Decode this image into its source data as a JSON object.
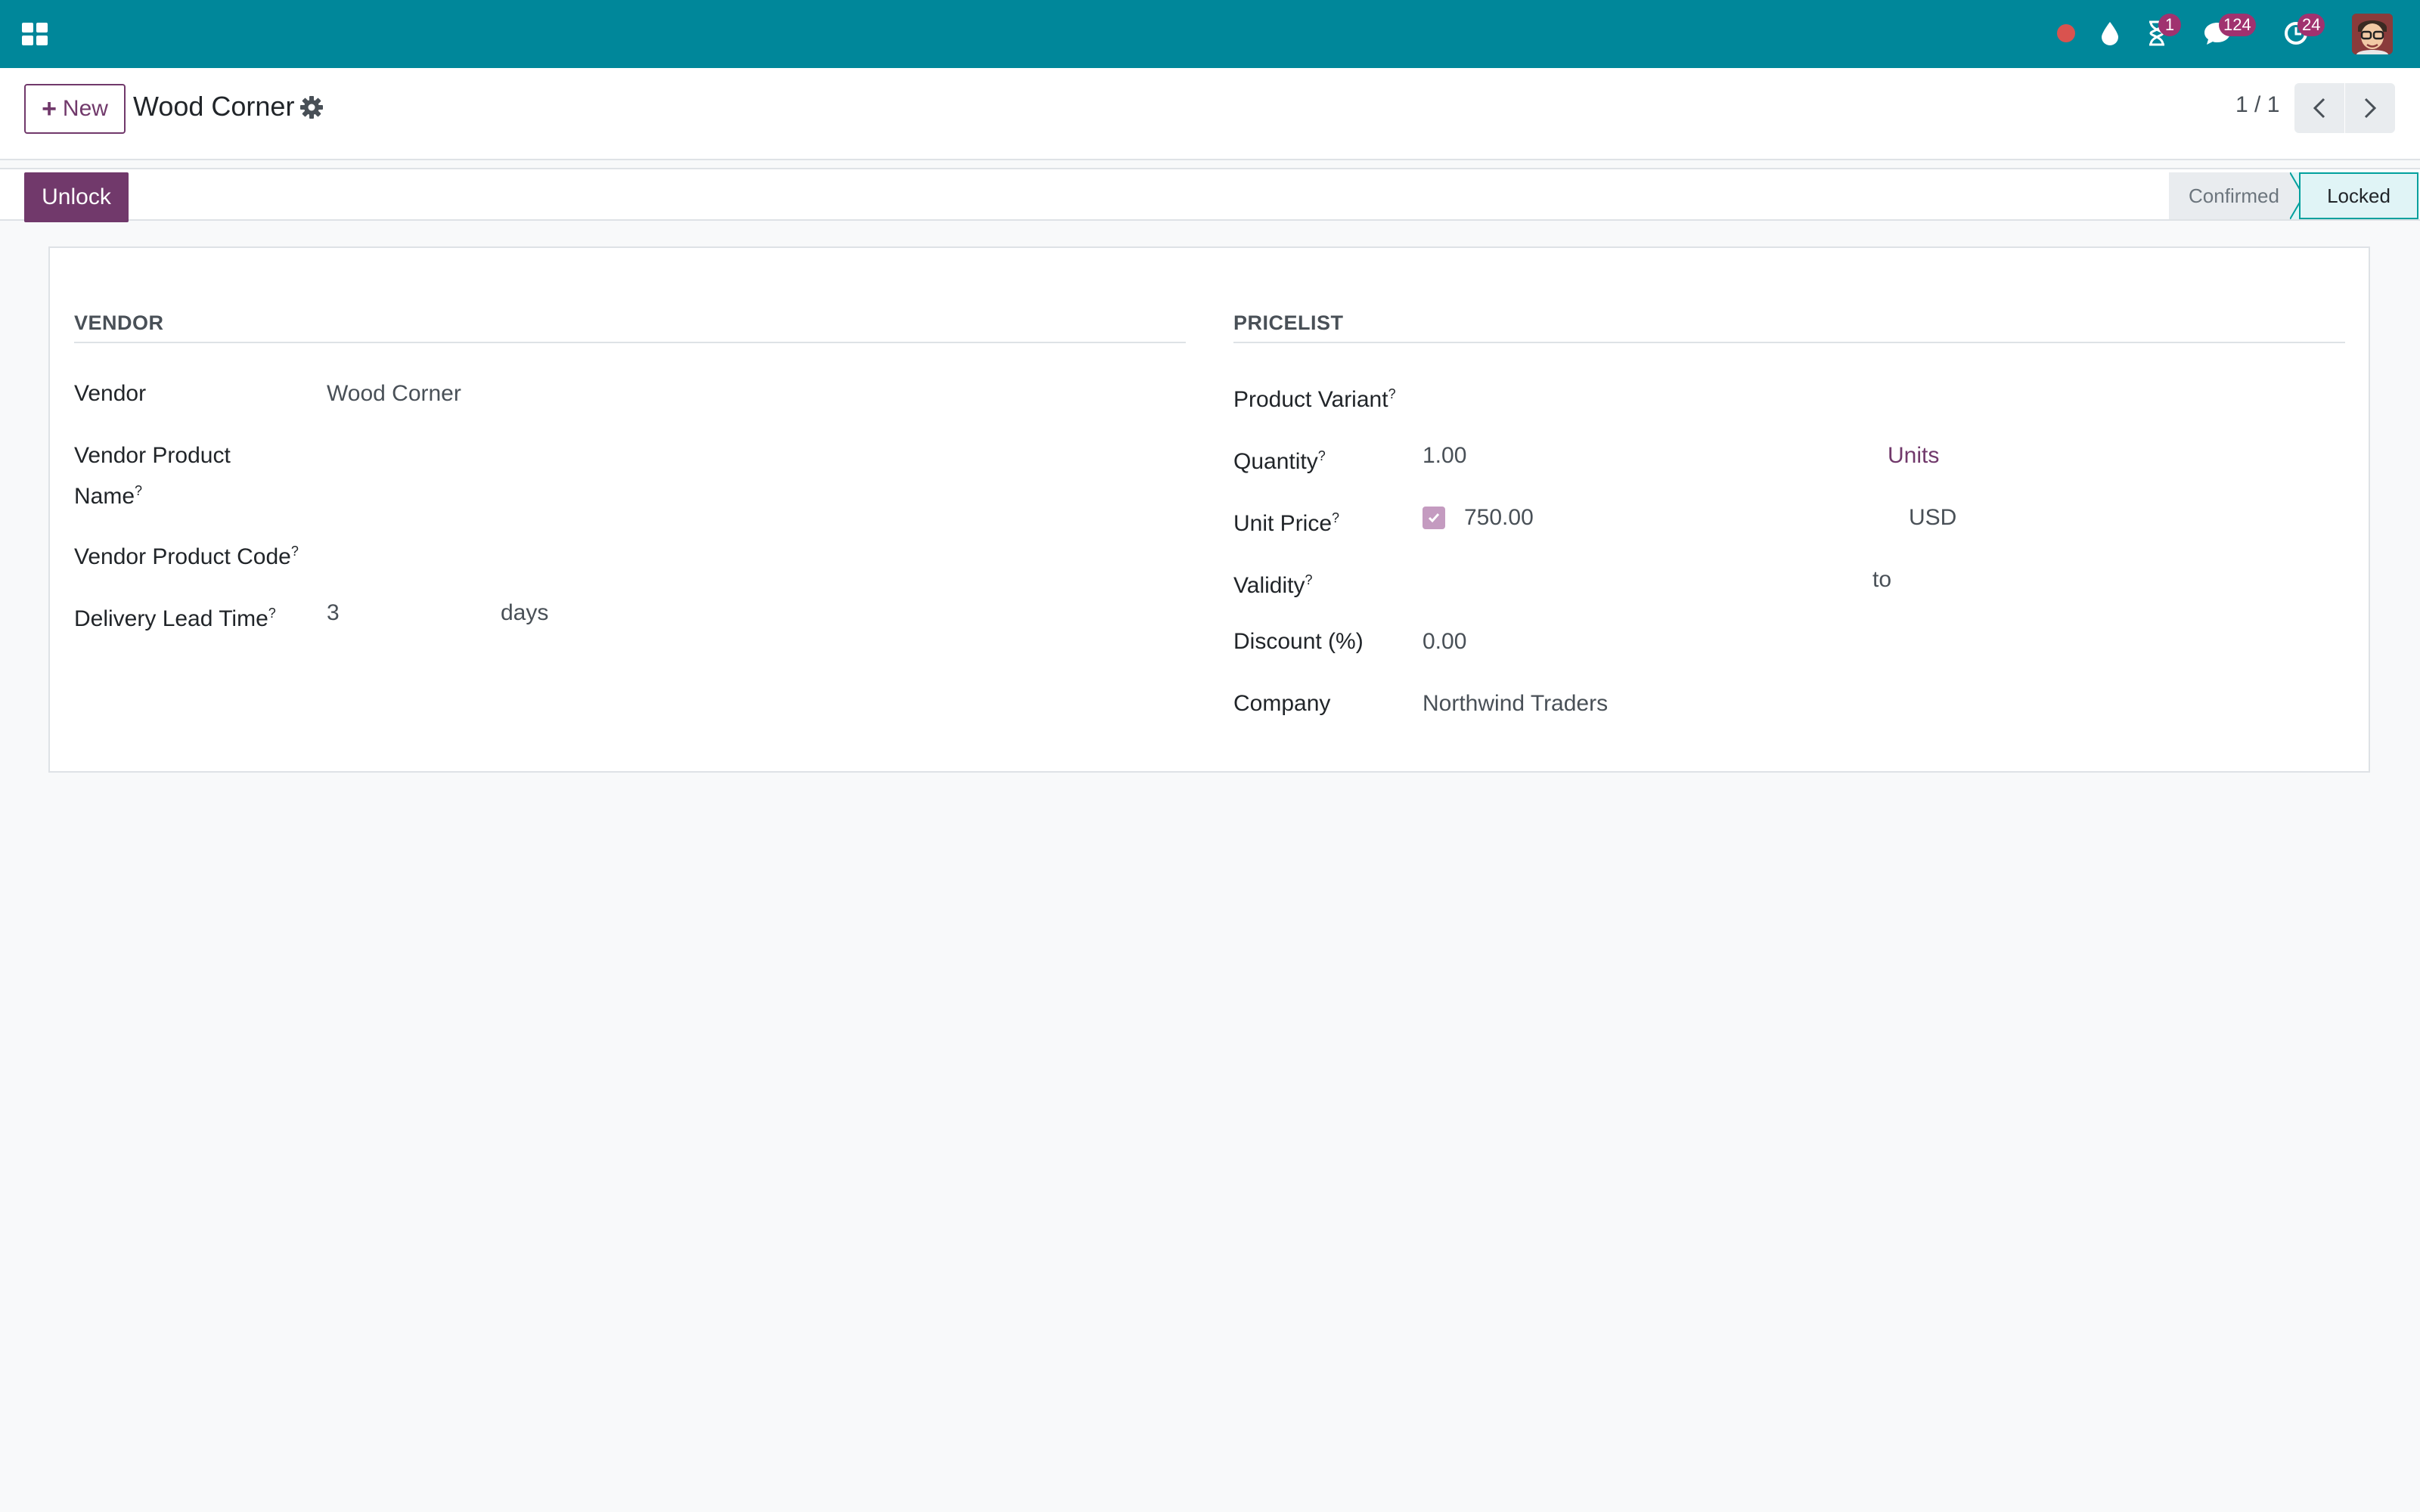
{
  "navbar": {
    "apps_icon": "apps-grid-icon",
    "icons": [
      {
        "name": "record-dot-icon",
        "color": "#d9534f"
      },
      {
        "name": "droplet-icon"
      },
      {
        "name": "hourglass-icon",
        "badge": "1"
      },
      {
        "name": "chat-icon",
        "badge": "124"
      },
      {
        "name": "activity-clock-icon",
        "badge": "24"
      }
    ],
    "avatar": "user-avatar"
  },
  "control_panel": {
    "new_button": "New",
    "title": "Wood Corner",
    "pager": "1 / 1"
  },
  "statusbar": {
    "unlock_button": "Unlock",
    "stages": [
      "Confirmed",
      "Locked"
    ],
    "active_stage": "Locked"
  },
  "form": {
    "vendor_section": {
      "title": "VENDOR",
      "fields": {
        "vendor": {
          "label": "Vendor",
          "value": "Wood Corner"
        },
        "vendor_product_name": {
          "label_line1": "Vendor Product",
          "label_line2": "Name",
          "help": "?"
        },
        "vendor_product_code": {
          "label": "Vendor Product Code",
          "help": "?"
        },
        "delivery_lead_time": {
          "label": "Delivery Lead Time",
          "help": "?",
          "value": "3",
          "unit": "days"
        }
      }
    },
    "pricelist_section": {
      "title": "PRICELIST",
      "fields": {
        "product_variant": {
          "label": "Product Variant",
          "help": "?"
        },
        "quantity": {
          "label": "Quantity",
          "help": "?",
          "value": "1.00",
          "unit": "Units"
        },
        "unit_price": {
          "label": "Unit Price",
          "help": "?",
          "value": "750.00",
          "currency": "USD",
          "checked": true
        },
        "validity": {
          "label": "Validity",
          "help": "?",
          "separator": "to"
        },
        "discount": {
          "label": "Discount (%)",
          "value": "0.00"
        },
        "company": {
          "label": "Company",
          "value": "Northwind Traders"
        }
      }
    }
  },
  "colors": {
    "navbar": "#00879a",
    "primary": "#71396b",
    "badge": "#a0326f",
    "active_stage_border": "#00a09d"
  }
}
